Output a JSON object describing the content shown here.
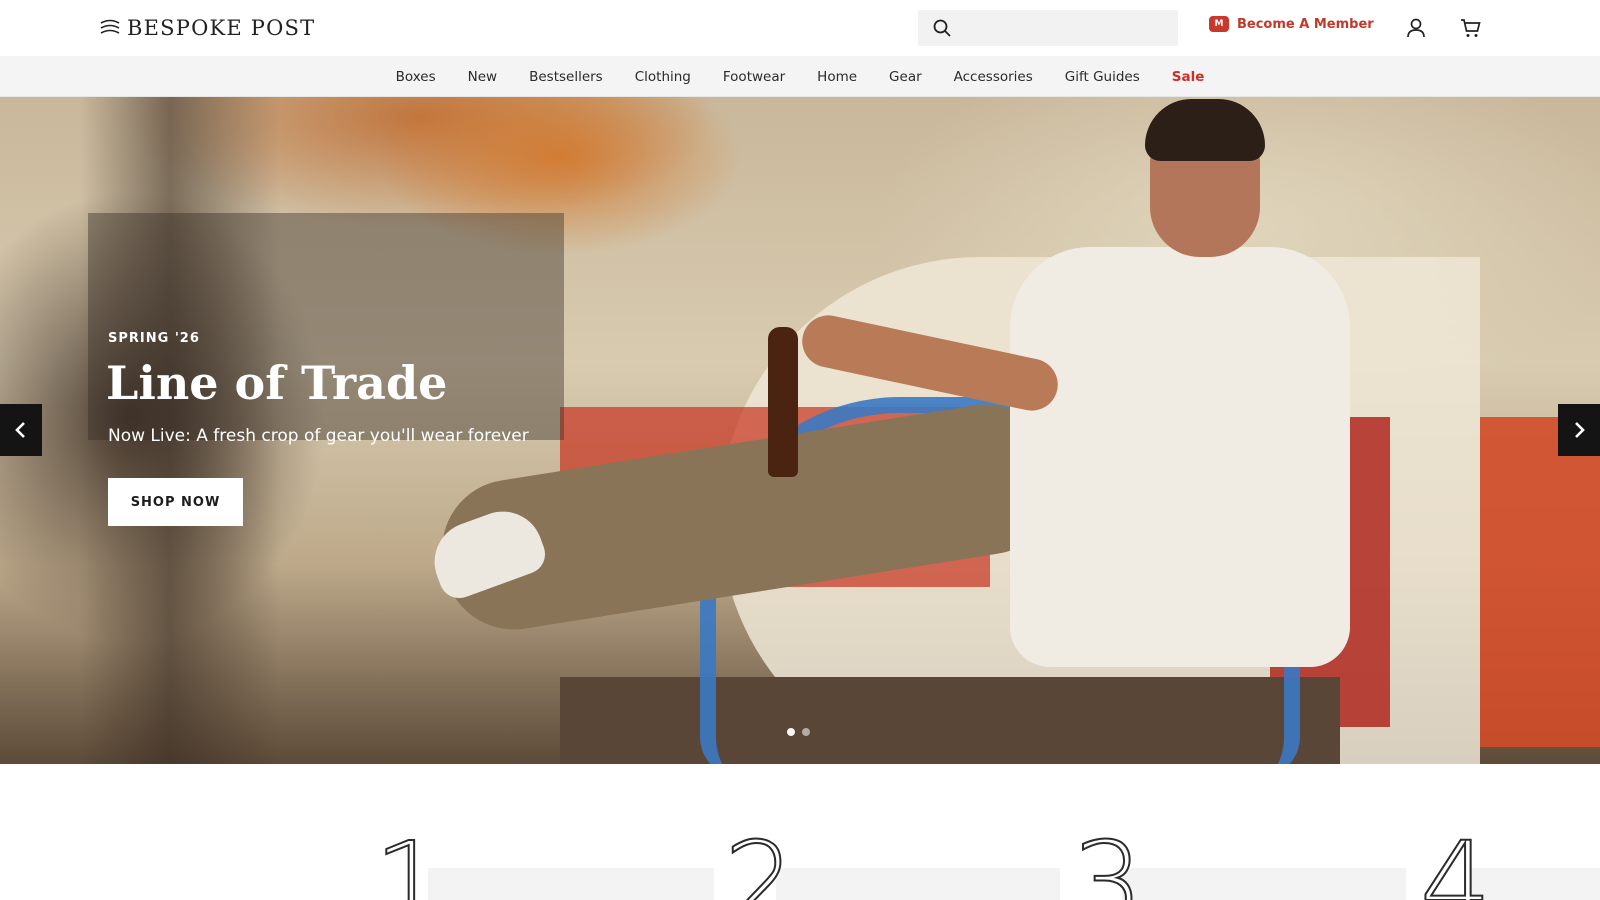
{
  "header": {
    "logo_text": "BESPOKE POST",
    "search": {
      "placeholder": "",
      "value": ""
    },
    "member_badge": "M",
    "member_label": "Become A Member",
    "icons": [
      "search-icon",
      "member-icon",
      "account-icon",
      "cart-icon"
    ]
  },
  "nav": {
    "items": [
      "Boxes",
      "New",
      "Bestsellers",
      "Clothing",
      "Footwear",
      "Home",
      "Gear",
      "Accessories",
      "Gift Guides",
      "Sale"
    ]
  },
  "hero": {
    "eyebrow": "SPRING '26",
    "title": "Line of Trade",
    "subtitle": "Now Live: A fresh crop of gear you'll wear forever",
    "cta": "SHOP NOW",
    "slides_total": 2,
    "active_slide": 1
  },
  "steps": {
    "numbers": [
      "1",
      "2",
      "3",
      "4"
    ]
  },
  "colors": {
    "accent_red": "#c0392b",
    "sale_red": "#d12d27",
    "nav_bg": "#f4f4f4",
    "search_bg": "#f2f2f2",
    "arrow_bg": "#141414"
  }
}
